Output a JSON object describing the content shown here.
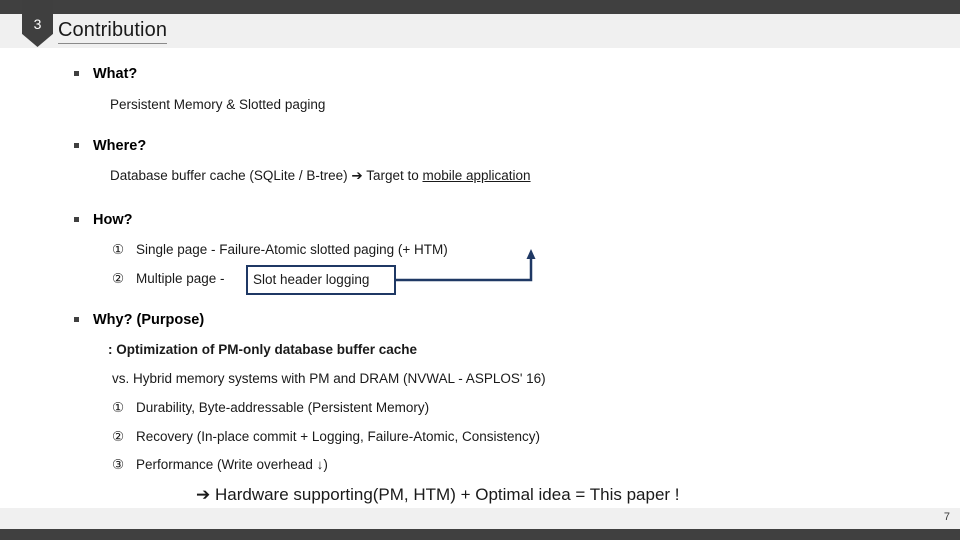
{
  "header": {
    "badge_number": "3",
    "title": "Contribution"
  },
  "sections": [
    {
      "heading": "What?",
      "lines": [
        {
          "text": "Persistent Memory & Slotted paging"
        }
      ]
    },
    {
      "heading": "Where?",
      "lines": [
        {
          "prefix": "Database buffer cache (SQLite / B-tree) ➔ Target to ",
          "underlined": "mobile application"
        }
      ]
    },
    {
      "heading": "How?",
      "items": [
        {
          "marker": "①",
          "text": "Single page - Failure-Atomic slotted paging (+ HTM)"
        },
        {
          "marker": "②",
          "prefix": "Multiple page - ",
          "boxed": "Slot header logging"
        }
      ]
    },
    {
      "heading": "Why? (Purpose)",
      "lines": [
        {
          "text": ":  Optimization of PM-only database buffer cache",
          "bold": true
        },
        {
          "text": "vs. Hybrid memory systems with PM and DRAM (NVWAL - ASPLOS' 16)"
        }
      ],
      "items": [
        {
          "marker": "①",
          "text": "Durability, Byte-addressable (Persistent Memory)"
        },
        {
          "marker": "②",
          "text": "Recovery (In-place commit + Logging, Failure-Atomic, Consistency)"
        },
        {
          "marker": "③",
          "text": "Performance (Write overhead ↓)"
        }
      ]
    }
  ],
  "conclusion": "➔ Hardware supporting(PM, HTM) + Optimal idea = This paper !",
  "footer": {
    "page_number": "7"
  },
  "colors": {
    "bar_dark": "#404040",
    "band_gray": "#f0f0f0",
    "box_navy": "#1F3864"
  }
}
